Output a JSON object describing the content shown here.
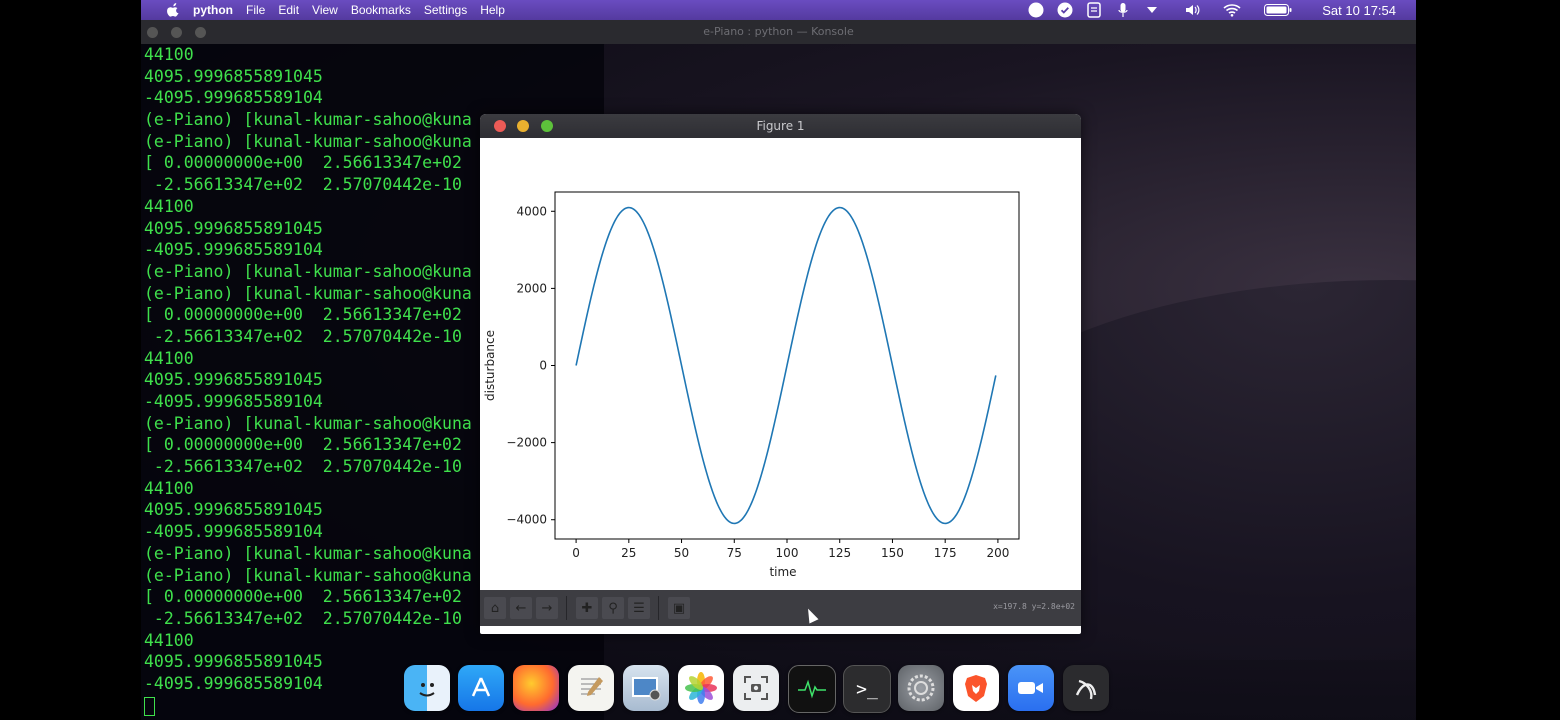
{
  "menubar": {
    "app_name": "python",
    "items": [
      "File",
      "Edit",
      "View",
      "Bookmarks",
      "Settings",
      "Help"
    ],
    "clock": "Sat 10 17:54"
  },
  "konsole": {
    "title": "e-Piano : python — Konsole",
    "lines": [
      "44100",
      "4095.9996855891045",
      "-4095.999685589104",
      "(e-Piano) [kunal-kumar-sahoo@kuna",
      "(e-Piano) [kunal-kumar-sahoo@kuna",
      "[ 0.00000000e+00  2.56613347e+02",
      " -2.56613347e+02  2.57070442e-10",
      "44100",
      "4095.9996855891045",
      "-4095.999685589104",
      "(e-Piano) [kunal-kumar-sahoo@kuna",
      "(e-Piano) [kunal-kumar-sahoo@kuna",
      "[ 0.00000000e+00  2.56613347e+02",
      " -2.56613347e+02  2.57070442e-10",
      "44100",
      "4095.9996855891045",
      "-4095.999685589104",
      "(e-Piano) [kunal-kumar-sahoo@kuna",
      "[ 0.00000000e+00  2.56613347e+02",
      " -2.56613347e+02  2.57070442e-10",
      "44100",
      "4095.9996855891045",
      "-4095.999685589104",
      "(e-Piano) [kunal-kumar-sahoo@kuna",
      "(e-Piano) [kunal-kumar-sahoo@kuna",
      "[ 0.00000000e+00  2.56613347e+02",
      " -2.56613347e+02  2.57070442e-10",
      "44100",
      "4095.9996855891045",
      "-4095.999685589104"
    ]
  },
  "figure": {
    "title": "Figure 1",
    "toolbar_buttons": [
      "home-icon",
      "back-icon",
      "forward-icon",
      "pan-icon",
      "zoom-icon",
      "configure-subplots-icon",
      "save-icon"
    ],
    "coords_readout": "x=197.8 y=2.8e+02"
  },
  "chart_data": {
    "type": "line",
    "title": "",
    "xlabel": "time",
    "ylabel": "disturbance",
    "xlim": [
      -10,
      210
    ],
    "ylim": [
      -4500,
      4500
    ],
    "xticks": [
      0,
      25,
      50,
      75,
      100,
      125,
      150,
      175,
      200
    ],
    "yticks": [
      4000,
      2000,
      0,
      -2000,
      -4000
    ],
    "series": [
      {
        "color": "#1f77b4",
        "function": "4096*sin(2*pi*x/100)",
        "x_range": [
          0,
          199
        ]
      }
    ],
    "grid": false
  },
  "dock": {
    "icons": [
      "finder-icon",
      "app-store-icon",
      "firefox-icon",
      "textedit-icon",
      "preview-icon",
      "photos-icon",
      "screenshot-icon",
      "activity-monitor-icon",
      "terminal-icon",
      "system-preferences-icon",
      "brave-icon",
      "zoom-icon",
      "anaconda-icon"
    ]
  },
  "colors": {
    "menubar": "#5b3fa8",
    "terminal_text": "#3fe04c",
    "plot_line": "#1f77b4"
  }
}
